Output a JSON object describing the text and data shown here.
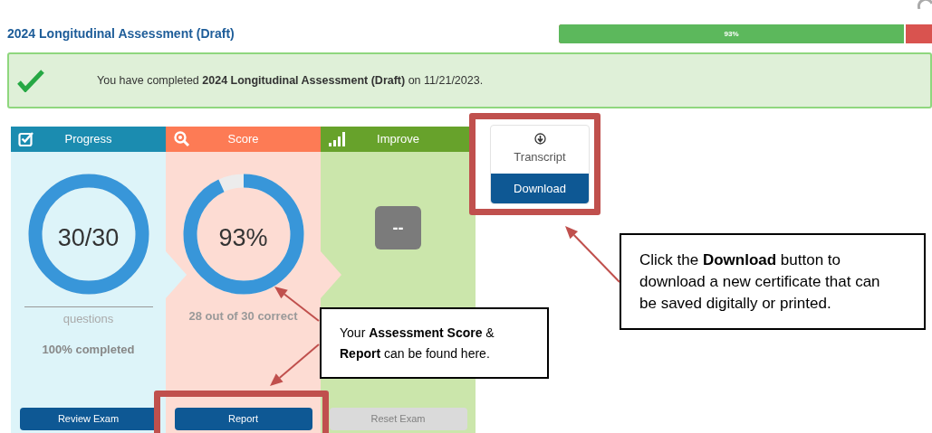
{
  "header": {
    "title": "2024 Longitudinal Assessment (Draft)",
    "progress": {
      "label": "93%",
      "level": 0.93
    }
  },
  "banner": {
    "message": "You have completed **2024 Longitudinal Assessment (Draft)** on 11/21/2023."
  },
  "panels": [
    {
      "kind": "progress",
      "title": "Progress",
      "ring_text": "30/30",
      "caption": "questions",
      "detail": "100% completed",
      "button": {
        "label": "Review Exam",
        "disabled": false
      }
    },
    {
      "kind": "score",
      "title": "Score",
      "ring_text": "93%",
      "caption": "28 out of 30 correct",
      "button": {
        "label": "Report",
        "disabled": false
      }
    },
    {
      "kind": "improve",
      "title": "Improve",
      "value": "--",
      "button": {
        "label": "Reset Exam",
        "disabled": true
      }
    }
  ],
  "transcript": {
    "label": "Transcript",
    "button": "Download"
  },
  "callouts": [
    {
      "text": "Click the **Download** button to download a new certificate that can be saved digitally or printed."
    },
    {
      "text": "Your **Assessment Score** & **Report** can be found here."
    }
  ]
}
